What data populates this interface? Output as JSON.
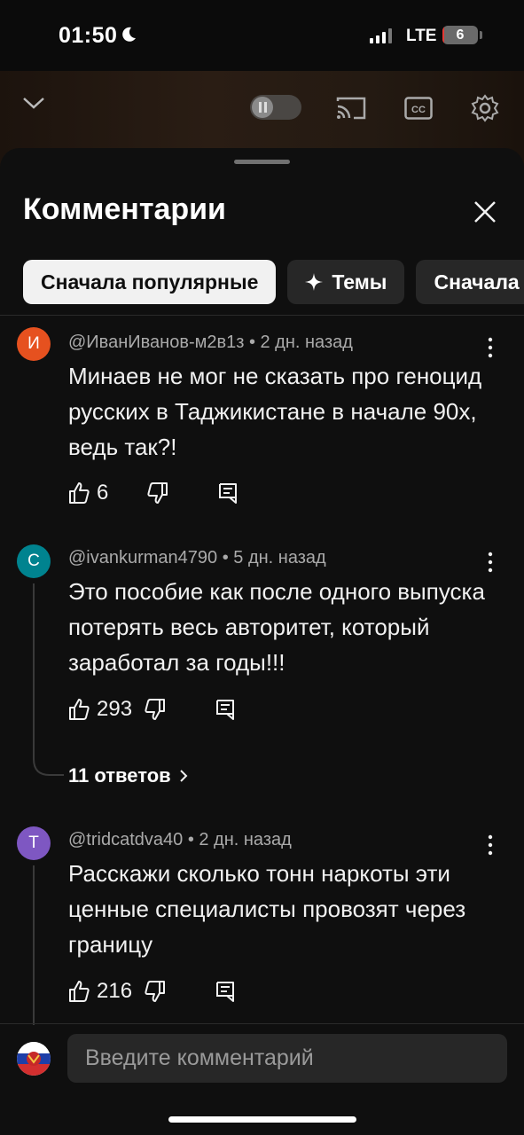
{
  "status_bar": {
    "time": "01:50",
    "network": "LTE",
    "battery": "6",
    "battery_level": 0.06,
    "icons": [
      "moon-icon",
      "signal-icon",
      "battery-icon"
    ]
  },
  "video_controls": {
    "icons": [
      "chevron-down-icon",
      "pause-icon",
      "cast-icon",
      "captions-icon",
      "settings-icon"
    ]
  },
  "sheet": {
    "title": "Комментарии",
    "close_icon": "close-icon"
  },
  "sort_chips": [
    {
      "label": "Сначала популярные",
      "active": true
    },
    {
      "label": "Темы",
      "icon": "sparkle-icon",
      "active": false
    },
    {
      "label": "Сначала",
      "active": false
    }
  ],
  "comments": [
    {
      "avatar_letter": "И",
      "avatar_color": "#e6511f",
      "meta": "@ИванИванов-м2в1з • 2 дн. назад",
      "text": "Минаев не мог не сказать про геноцид русских в Таджикистане в начале 90х, ведь так?!",
      "likes": "6"
    },
    {
      "avatar_letter": "C",
      "avatar_color": "#00838f",
      "meta": "@ivankurman4790 • 5 дн. назад",
      "text": "Это пособие как после одного выпуска потерять весь авторитет, который заработал за годы!!!",
      "likes": "293",
      "replies": "11 ответов"
    },
    {
      "avatar_letter": "T",
      "avatar_color": "#7e57c2",
      "meta": "@tridcatdva40 • 2 дн. назад",
      "text": "Расскажи сколько тонн наркоты эти ценные специалисты провозят через границу",
      "likes": "216"
    }
  ],
  "composer": {
    "placeholder": "Введите комментарий"
  }
}
